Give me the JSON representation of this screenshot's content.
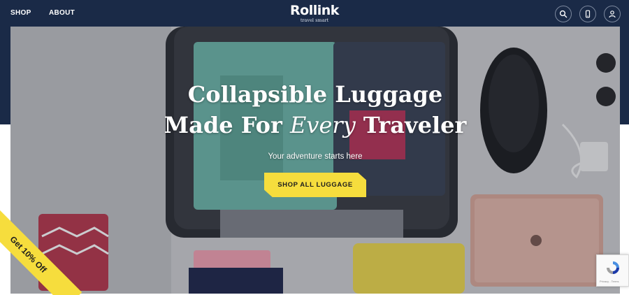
{
  "header": {
    "nav": [
      {
        "label": "SHOP"
      },
      {
        "label": "ABOUT"
      }
    ],
    "logo": {
      "name": "Rollink",
      "tagline": "travel smart"
    },
    "icons": [
      "search-icon",
      "phone-icon",
      "user-icon"
    ]
  },
  "hero": {
    "headline_line1": "Collapsible Luggage",
    "headline_line2_start": "Made For ",
    "headline_line2_em": "Every",
    "headline_line2_end": " Traveler",
    "subheading": "Your adventure starts here",
    "cta_label": "SHOP ALL LUGGAGE"
  },
  "promo": {
    "label": "Get 10% Off"
  },
  "recaptcha": {
    "text": "Privacy - Terms"
  },
  "colors": {
    "navy": "#1a2a47",
    "accent_yellow": "#f6dd3d",
    "white": "#ffffff"
  }
}
